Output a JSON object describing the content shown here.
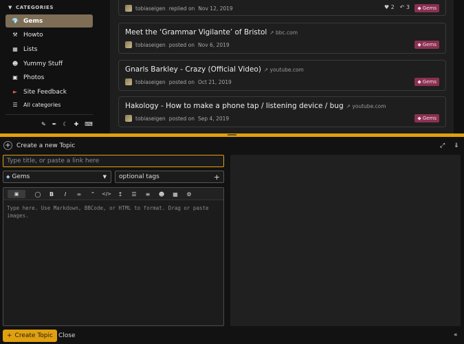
{
  "sidebar": {
    "header": "CATEGORIES",
    "items": [
      {
        "label": "Gems",
        "icon": "gem-icon"
      },
      {
        "label": "Howto",
        "icon": "hammer-icon"
      },
      {
        "label": "Lists",
        "icon": "clipboard-icon"
      },
      {
        "label": "Yummy Stuff",
        "icon": "chef-icon"
      },
      {
        "label": "Photos",
        "icon": "camera-icon"
      },
      {
        "label": "Site Feedback",
        "icon": "megaphone-icon"
      },
      {
        "label": "All categories",
        "icon": "list-icon"
      }
    ]
  },
  "topics": [
    {
      "title": "",
      "domain": "",
      "author": "tobiaseigen",
      "action": "replied on",
      "date": "Nov 12, 2019",
      "likes": "2",
      "replies": "3",
      "tag": "Gems"
    },
    {
      "title": "Meet the ‘Grammar Vigilante’ of Bristol",
      "domain": "bbc.com",
      "author": "tobiaseigen",
      "action": "posted on",
      "date": "Nov 6, 2019",
      "tag": "Gems"
    },
    {
      "title": "Gnarls Barkley - Crazy (Official Video)",
      "domain": "youtube.com",
      "author": "tobiaseigen",
      "action": "posted on",
      "date": "Oct 21, 2019",
      "tag": "Gems"
    },
    {
      "title": "Hakology - How to make a phone tap / listening device / bug",
      "domain": "youtube.com",
      "author": "tobiaseigen",
      "action": "posted on",
      "date": "Sep 4, 2019",
      "tag": "Gems"
    }
  ],
  "composer": {
    "header": "Create a new Topic",
    "title_placeholder": "Type title, or paste a link here",
    "category": "Gems",
    "tags_placeholder": "optional tags",
    "editor_placeholder": "Type here. Use Markdown, BBCode, or HTML to format. Drag or paste images.",
    "create_label": "Create Topic",
    "close_label": "Close"
  },
  "colors": {
    "accent": "#e1a00e",
    "active_category": "#7e6e55",
    "tag_bg": "#8a3152"
  }
}
